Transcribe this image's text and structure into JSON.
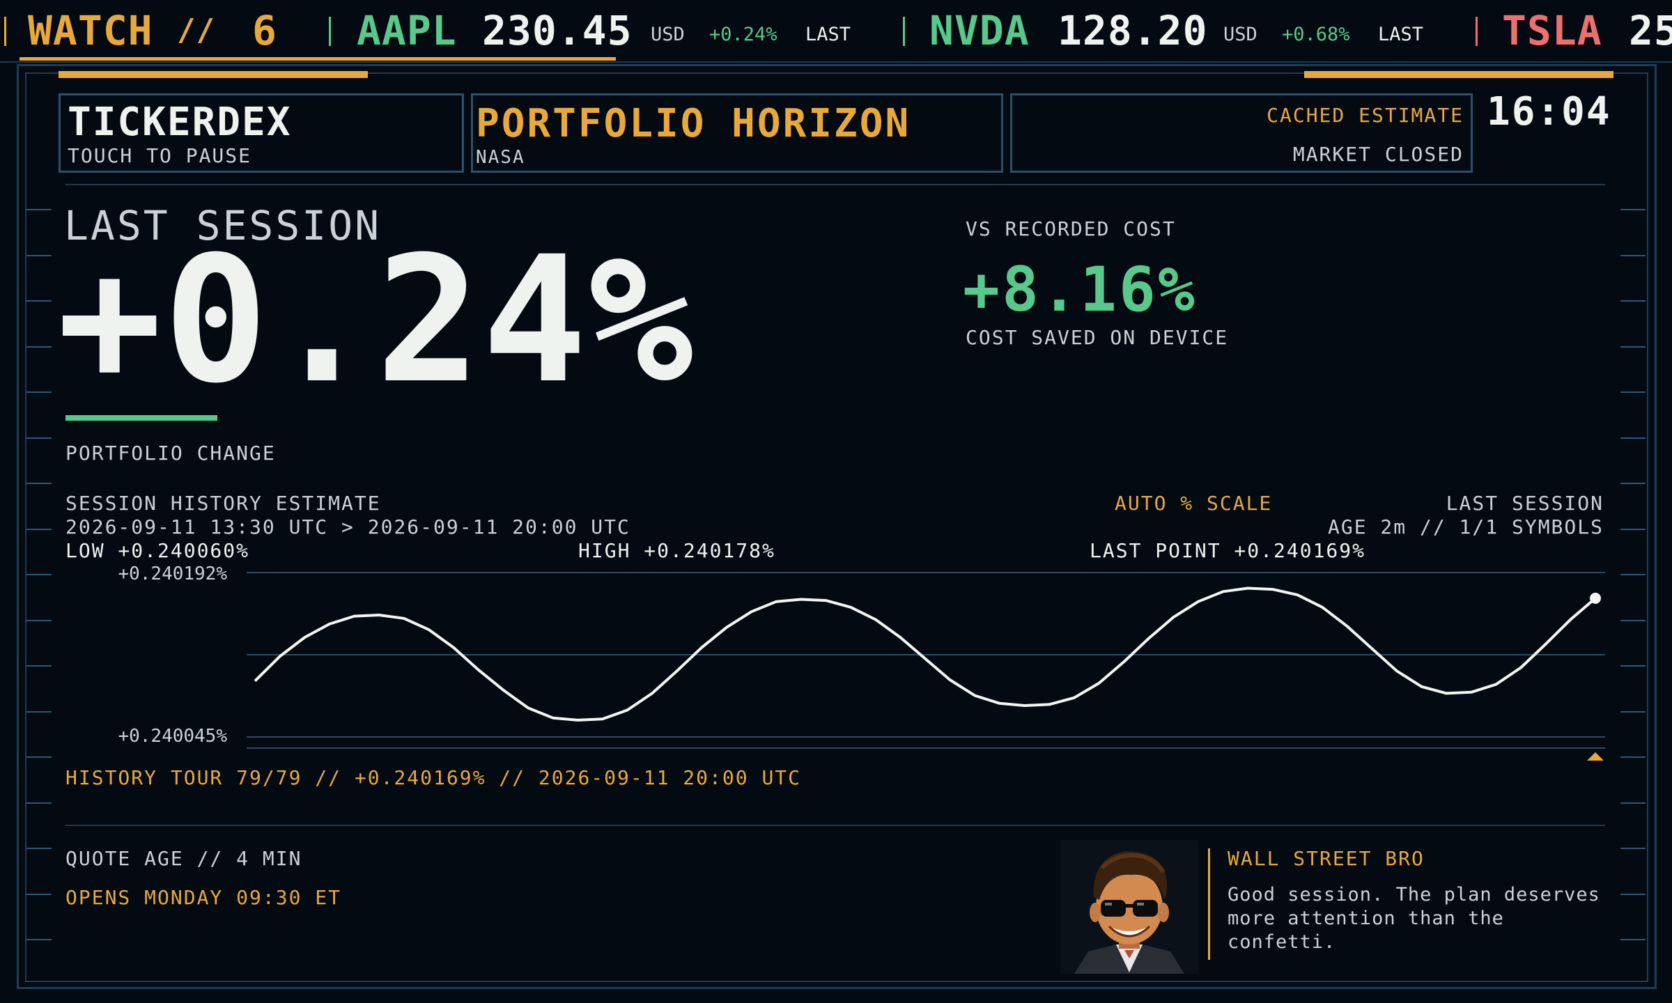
{
  "ticker": {
    "watch_label": "WATCH",
    "watch_sep": "//",
    "watch_count": "6",
    "items": [
      {
        "symbol": "AAPL",
        "price": "230.45",
        "currency": "USD",
        "change": "+0.24%",
        "state": "LAST"
      },
      {
        "symbol": "NVDA",
        "price": "128.20",
        "currency": "USD",
        "change": "+0.68%",
        "state": "LAST"
      },
      {
        "symbol": "TSLA",
        "price": "25"
      }
    ]
  },
  "header": {
    "app_name": "TICKERDEX",
    "app_hint": "TOUCH TO PAUSE",
    "portfolio_title": "PORTFOLIO HORIZON",
    "portfolio_sub": "NASA",
    "status_primary": "CACHED ESTIMATE",
    "status_secondary": "MARKET CLOSED",
    "clock": "16:04"
  },
  "summary": {
    "session_label": "LAST SESSION",
    "session_change": "+0.24%",
    "change_label": "PORTFOLIO CHANGE",
    "cost_label": "VS RECORDED COST",
    "cost_change": "+8.16%",
    "cost_note": "COST SAVED ON DEVICE"
  },
  "history": {
    "title": "SESSION HISTORY ESTIMATE",
    "range": "2026-09-11 13:30 UTC > 2026-09-11 20:00 UTC",
    "scale_label": "AUTO % SCALE",
    "session_label": "LAST SESSION",
    "age_info": "AGE 2m // 1/1 SYMBOLS",
    "low": "LOW +0.240060%",
    "high": "HIGH +0.240178%",
    "last_point": "LAST POINT +0.240169%",
    "tour": "HISTORY TOUR 79/79 // +0.240169% // 2026-09-11 20:00 UTC"
  },
  "chart_data": {
    "type": "line",
    "ytick_labels": [
      "+0.240192%",
      "+0.240045%"
    ],
    "ylim": [
      0.240045,
      0.240192
    ],
    "x_range": [
      "2026-09-11 13:30 UTC",
      "2026-09-11 20:00 UTC"
    ],
    "point_count": 79,
    "series": [
      {
        "values": [
          0.240095,
          0.240117,
          0.240134,
          0.240146,
          0.240153,
          0.240154,
          0.240151,
          0.240141,
          0.240125,
          0.240105,
          0.240087,
          0.240071,
          0.240062,
          0.24006,
          0.240061,
          0.240069,
          0.240084,
          0.240104,
          0.240125,
          0.240143,
          0.240157,
          0.240166,
          0.240168,
          0.240167,
          0.240161,
          0.24015,
          0.240134,
          0.240115,
          0.240096,
          0.240082,
          0.240075,
          0.240073,
          0.240074,
          0.24008,
          0.240093,
          0.240112,
          0.240133,
          0.240152,
          0.240166,
          0.240175,
          0.240178,
          0.240177,
          0.240172,
          0.240161,
          0.240144,
          0.240124,
          0.240104,
          0.24009,
          0.240084,
          0.240085,
          0.240092,
          0.240107,
          0.240128,
          0.24015,
          0.240169
        ]
      }
    ],
    "grid": true
  },
  "footer": {
    "quote_age": "QUOTE AGE // 4 MIN",
    "opens": "OPENS MONDAY 09:30 ET",
    "advisor_name": "WALL STREET BRO",
    "advisor_message": "Good session. The plan deserves more attention than the confetti.",
    "advisor_lines": [
      "Good session. The plan deserves",
      "more attention than the",
      "confetti."
    ]
  },
  "colors": {
    "background": "#030a12",
    "accent": "#e9a93a",
    "positive": "#58c98a",
    "negative": "#ef6f6f",
    "frame": "#1d3d56"
  }
}
